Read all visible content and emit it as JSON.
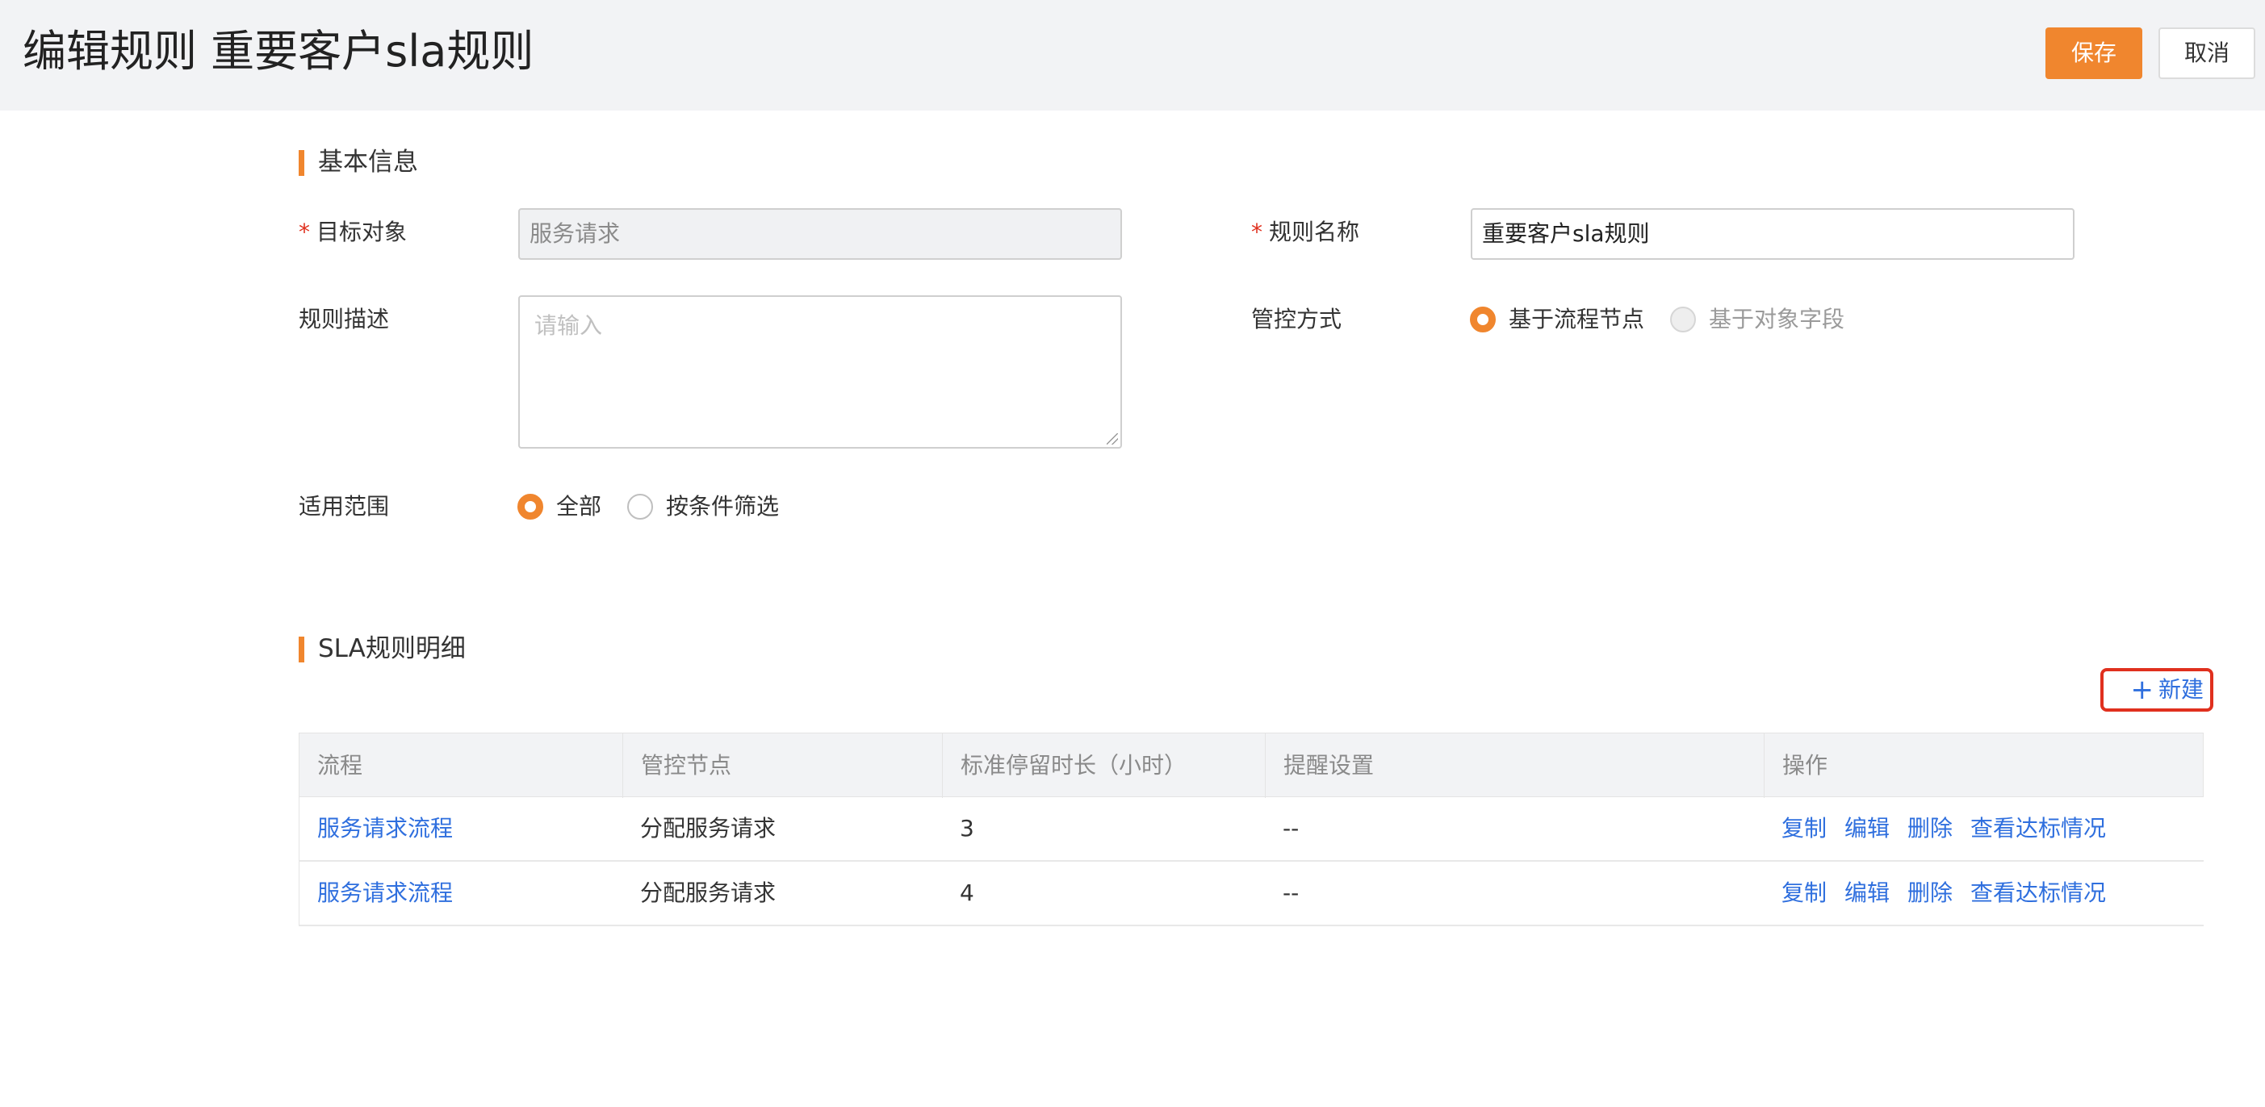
{
  "header": {
    "title": "编辑规则 重要客户sla规则",
    "save_label": "保存",
    "cancel_label": "取消"
  },
  "basic_info": {
    "section_title": "基本信息",
    "target_object": {
      "label": "目标对象",
      "value": "服务请求",
      "required": true
    },
    "rule_name": {
      "label": "规则名称",
      "value": "重要客户sla规则",
      "required": true
    },
    "rule_description": {
      "label": "规则描述",
      "placeholder": "请输入"
    },
    "control_mode": {
      "label": "管控方式",
      "options": [
        {
          "label": "基于流程节点",
          "checked": true,
          "disabled": false
        },
        {
          "label": "基于对象字段",
          "checked": false,
          "disabled": true
        }
      ]
    },
    "scope": {
      "label": "适用范围",
      "options": [
        {
          "label": "全部",
          "checked": true
        },
        {
          "label": "按条件筛选",
          "checked": false
        }
      ]
    }
  },
  "sla_details": {
    "section_title": "SLA规则明细",
    "new_button_label": "新建",
    "new_button_icon": "plus-icon",
    "columns": [
      "流程",
      "管控节点",
      "标准停留时长（小时）",
      "提醒设置",
      "操作"
    ],
    "rows": [
      {
        "process": "服务请求流程",
        "node": "分配服务请求",
        "duration": "3",
        "reminder": "--",
        "actions": [
          "复制",
          "编辑",
          "删除",
          "查看达标情况"
        ]
      },
      {
        "process": "服务请求流程",
        "node": "分配服务请求",
        "duration": "4",
        "reminder": "--",
        "actions": [
          "复制",
          "编辑",
          "删除",
          "查看达标情况"
        ]
      }
    ]
  },
  "colors": {
    "accent": "#f0862e",
    "link": "#2f6fde",
    "required": "#e0301e",
    "highlight_border": "#e0301e"
  }
}
